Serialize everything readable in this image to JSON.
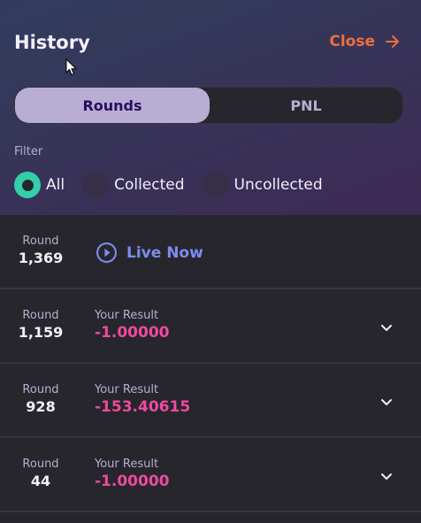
{
  "header": {
    "title": "History",
    "close_label": "Close"
  },
  "tabs": [
    {
      "label": "Rounds",
      "active": true
    },
    {
      "label": "PNL",
      "active": false
    }
  ],
  "filter": {
    "label": "Filter",
    "options": [
      {
        "label": "All",
        "checked": true
      },
      {
        "label": "Collected",
        "checked": false
      },
      {
        "label": "Uncollected",
        "checked": false
      }
    ]
  },
  "live_row": {
    "round_label": "Round",
    "round_number": "1,369",
    "live_label": "Live Now"
  },
  "rows": [
    {
      "round_label": "Round",
      "round_number": "1,159",
      "result_label": "Your Result",
      "result_value": "-1.00000"
    },
    {
      "round_label": "Round",
      "round_number": "928",
      "result_label": "Your Result",
      "result_value": "-153.40615"
    },
    {
      "round_label": "Round",
      "round_number": "44",
      "result_label": "Your Result",
      "result_value": "-1.00000"
    }
  ],
  "colors": {
    "accent_orange": "#ef6f3c",
    "negative": "#ed4b9e",
    "radio_checked": "#31d0aa",
    "live": "#7b8ef0"
  }
}
